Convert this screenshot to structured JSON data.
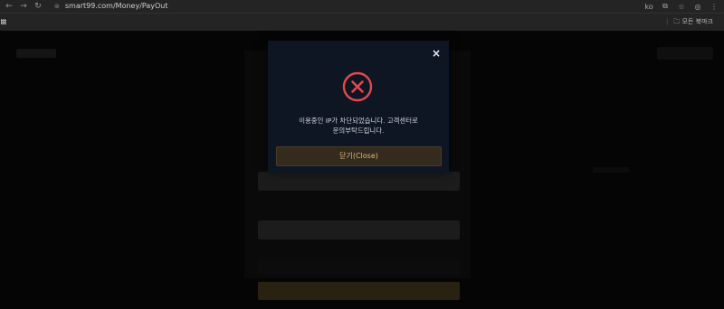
{
  "browser": {
    "url": "smart99.com/Money/PayOut",
    "nav_icons": [
      "back-icon",
      "forward-icon",
      "reload-icon"
    ],
    "right_icons": [
      "translate-icon",
      "extensions-icon",
      "bookmark-star-icon",
      "profile-icon",
      "menu-icon"
    ],
    "right_icon_labels": [
      "ko",
      "",
      "☆",
      "",
      "⋮"
    ],
    "all_bookmarks_label": "모든 북마크"
  },
  "modal": {
    "close_symbol": "×",
    "message_line1": "이용중인 IP가 차단되었습니다. 고객센터로",
    "message_line2": "문의부탁드립니다.",
    "close_button_label": "닫기(Close)",
    "icon": "error-circle-x-icon",
    "icon_color": "#e0494e",
    "button_text_color": "#d6b978"
  },
  "form": {
    "field1_label": "",
    "field1_value": "",
    "field2_label": "",
    "field2_value": ""
  }
}
